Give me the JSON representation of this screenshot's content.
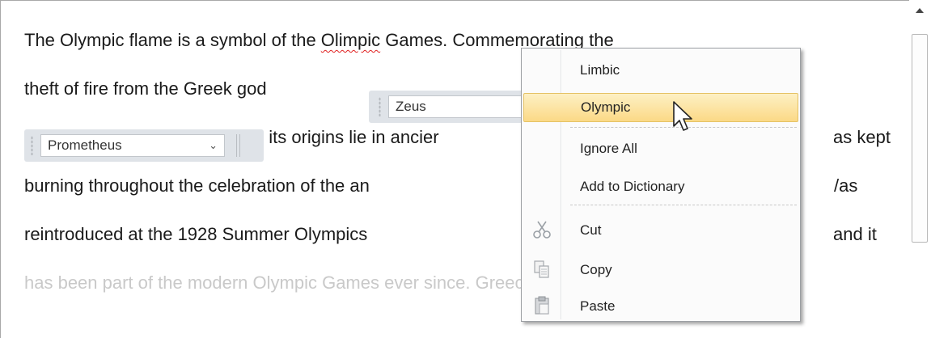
{
  "document": {
    "line1_a": "The Olympic flame is a symbol of the ",
    "line1_misspelled": "Olimpic",
    "line1_b": " Games. Commemorating the",
    "line2": "theft of fire from the Greek god",
    "line3_a": ", its origins lie in ancier",
    "line3_b": "as kept",
    "line4_a": "burning throughout the celebration of the an",
    "line4_b": "/as",
    "line5_a": "reintroduced at the 1928 Summer Olympics",
    "line5_b": "and it",
    "line6": "has been part of the modern Olympic Games ever since. Greece had no"
  },
  "combos": {
    "first_value": "Zeus",
    "second_value": "Prometheus"
  },
  "context_menu": {
    "suggestions": [
      "Limbic",
      "Olympic"
    ],
    "highlighted": "Olympic",
    "ignore_all": "Ignore All",
    "add_to_dictionary": "Add to Dictionary",
    "cut": "Cut",
    "copy": "Copy",
    "paste": "Paste",
    "icons": [
      "scissors-icon",
      "copy-icon",
      "paste-icon"
    ]
  },
  "colors": {
    "highlight_top": "#fdf0c4",
    "highlight_bottom": "#fbd986",
    "spell_underline": "#e02020"
  }
}
